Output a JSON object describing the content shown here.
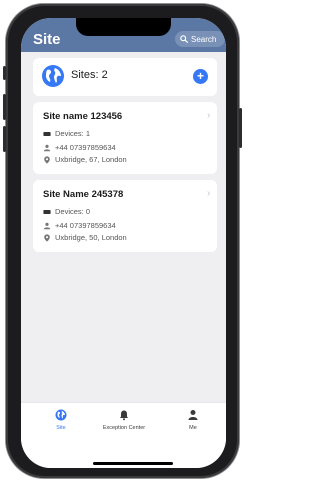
{
  "header": {
    "title": "Site",
    "search_label": "Search"
  },
  "summary": {
    "sites_label": "Sites: 2"
  },
  "sites": [
    {
      "name": "Site name 123456",
      "devices": "Devices: 1",
      "phone": "+44 07397859634",
      "address": "Uxbridge, 67, London"
    },
    {
      "name": "Site Name 245378",
      "devices": "Devices: 0",
      "phone": "+44 07397859634",
      "address": "Uxbridge, 50, London"
    }
  ],
  "tabbar": {
    "tabs": [
      {
        "label": "Site",
        "icon": "globe-icon",
        "active": true
      },
      {
        "label": "Exception Center",
        "icon": "bell-icon",
        "active": false
      },
      {
        "label": "Me",
        "icon": "person-icon",
        "active": false
      }
    ]
  },
  "colors": {
    "header": "#5b77a3",
    "accent": "#3478f6",
    "background": "#efeff2"
  }
}
